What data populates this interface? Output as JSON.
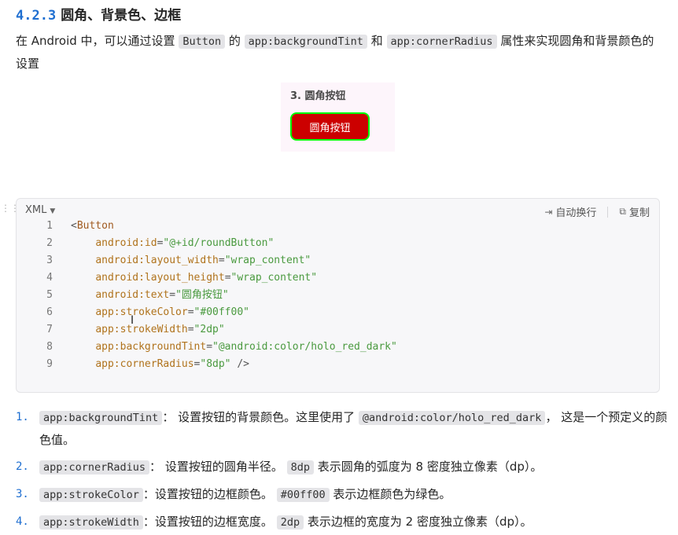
{
  "heading": {
    "number": "4.2.3",
    "title": "圆角、背景色、边框"
  },
  "intro": {
    "t1": "在 Android 中，可以通过设置 ",
    "c1": "Button",
    "t2": " 的 ",
    "c2": "app:backgroundTint",
    "t3": " 和 ",
    "c3": "app:cornerRadius",
    "t4": " 属性来实现圆角和背景颜色的设置"
  },
  "preview": {
    "title": "3. 圆角按钮",
    "button_label": "圆角按钮",
    "button_bg": "#cc0000",
    "button_border": "#00ff00"
  },
  "code": {
    "language": "XML",
    "wrap_label": "自动换行",
    "copy_label": "复制",
    "lines": [
      {
        "num": "1",
        "parts": [
          [
            "punc",
            "<"
          ],
          [
            "tag",
            "Button"
          ]
        ]
      },
      {
        "num": "2",
        "parts": [
          [
            "punc",
            "    "
          ],
          [
            "attr",
            "android:id"
          ],
          [
            "punc",
            "="
          ],
          [
            "str",
            "\"@+id/roundButton\""
          ]
        ]
      },
      {
        "num": "3",
        "parts": [
          [
            "punc",
            "    "
          ],
          [
            "attr",
            "android:layout_width"
          ],
          [
            "punc",
            "="
          ],
          [
            "str",
            "\"wrap_content\""
          ]
        ]
      },
      {
        "num": "4",
        "parts": [
          [
            "punc",
            "    "
          ],
          [
            "attr",
            "android:layout_height"
          ],
          [
            "punc",
            "="
          ],
          [
            "str",
            "\"wrap_content\""
          ]
        ]
      },
      {
        "num": "5",
        "parts": [
          [
            "punc",
            "    "
          ],
          [
            "attr",
            "android:text"
          ],
          [
            "punc",
            "="
          ],
          [
            "str",
            "\"圆角按钮\""
          ]
        ]
      },
      {
        "num": "6",
        "parts": [
          [
            "punc",
            "    "
          ],
          [
            "attr",
            "app:strokeColor"
          ],
          [
            "punc",
            "="
          ],
          [
            "str",
            "\"#00ff00\""
          ]
        ]
      },
      {
        "num": "7",
        "parts": [
          [
            "punc",
            "    "
          ],
          [
            "attr",
            "app:strokeWidth"
          ],
          [
            "punc",
            "="
          ],
          [
            "str",
            "\"2dp\""
          ]
        ]
      },
      {
        "num": "8",
        "parts": [
          [
            "punc",
            "    "
          ],
          [
            "attr",
            "app:backgroundTint"
          ],
          [
            "punc",
            "="
          ],
          [
            "str",
            "\"@android:color/holo_red_dark\""
          ]
        ]
      },
      {
        "num": "9",
        "parts": [
          [
            "punc",
            "    "
          ],
          [
            "attr",
            "app:cornerRadius"
          ],
          [
            "punc",
            "="
          ],
          [
            "str",
            "\"8dp\""
          ],
          [
            "punc",
            " />"
          ]
        ]
      }
    ]
  },
  "list": [
    {
      "num": "1.",
      "c1": "app:backgroundTint",
      "t1": "： 设置按钮的背景颜色。这里使用了 ",
      "c2": "@android:color/holo_red_dark",
      "t2": "， 这是一个预定义的颜色值。"
    },
    {
      "num": "2.",
      "c1": "app:cornerRadius",
      "t1": "： 设置按钮的圆角半径。 ",
      "c2": "8dp",
      "t2": " 表示圆角的弧度为 8 密度独立像素（dp）。"
    },
    {
      "num": "3.",
      "c1": "app:strokeColor",
      "t1": "：设置按钮的边框颜色。 ",
      "c2": "#00ff00",
      "t2": " 表示边框颜色为绿色。"
    },
    {
      "num": "4.",
      "c1": "app:strokeWidth",
      "t1": "：设置按钮的边框宽度。 ",
      "c2": "2dp",
      "t2": " 表示边框的宽度为 2 密度独立像素（dp）。"
    }
  ]
}
